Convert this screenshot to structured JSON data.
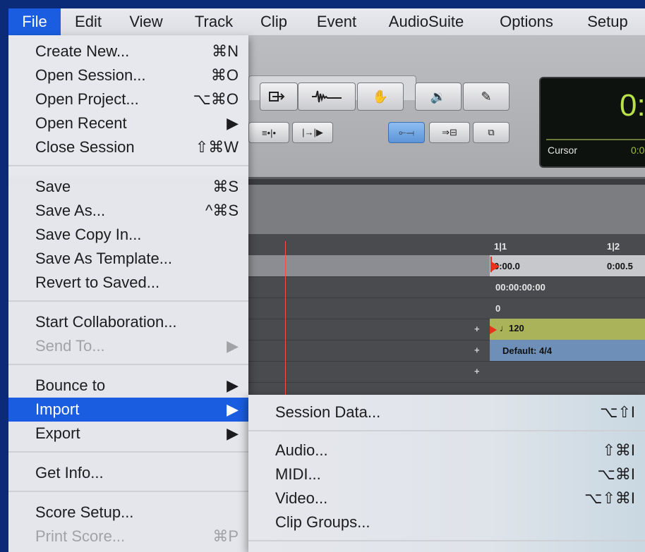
{
  "menubar": {
    "items": [
      "File",
      "Edit",
      "View",
      "Track",
      "Clip",
      "Event",
      "AudioSuite",
      "Options",
      "Setup"
    ]
  },
  "counter": {
    "main": "0:",
    "cursor_label": "Cursor",
    "cursor_value": "0:0"
  },
  "rulers": {
    "bar1": "1|1",
    "bar2": "1|2",
    "min_a": "0:00.0",
    "min_b": "0:00.5",
    "timecode": "00:00:00:00",
    "samples": "0",
    "tempo": "120",
    "meter": "Default: 4/4",
    "plus": "+"
  },
  "file_menu": {
    "items": [
      {
        "label": "Create New...",
        "shortcut": "⌘N"
      },
      {
        "label": "Open Session...",
        "shortcut": "⌘O"
      },
      {
        "label": "Open Project...",
        "shortcut": "⌥⌘O"
      },
      {
        "label": "Open Recent",
        "shortcut": "▶"
      },
      {
        "label": "Close Session",
        "shortcut": "⇧⌘W"
      },
      {
        "label": "Save",
        "shortcut": "⌘S"
      },
      {
        "label": "Save As...",
        "shortcut": "^⌘S"
      },
      {
        "label": "Save Copy In...",
        "shortcut": ""
      },
      {
        "label": "Save As Template...",
        "shortcut": ""
      },
      {
        "label": "Revert to Saved...",
        "shortcut": ""
      },
      {
        "label": "Start Collaboration...",
        "shortcut": ""
      },
      {
        "label": "Send To...",
        "shortcut": "▶"
      },
      {
        "label": "Bounce to",
        "shortcut": "▶"
      },
      {
        "label": "Import",
        "shortcut": "▶"
      },
      {
        "label": "Export",
        "shortcut": "▶"
      },
      {
        "label": "Get Info...",
        "shortcut": ""
      },
      {
        "label": "Score Setup...",
        "shortcut": ""
      },
      {
        "label": "Print Score...",
        "shortcut": "⌘P"
      }
    ]
  },
  "import_submenu": {
    "items": [
      {
        "label": "Session Data...",
        "shortcut": "⌥⇧I"
      },
      {
        "label": "Audio...",
        "shortcut": "⇧⌘I"
      },
      {
        "label": "MIDI...",
        "shortcut": "⌥⌘I"
      },
      {
        "label": "Video...",
        "shortcut": "⌥⇧⌘I"
      },
      {
        "label": "Clip Groups...",
        "shortcut": ""
      }
    ]
  },
  "colors": {
    "highlight": "#1a5de0",
    "counter_text": "#b9e24a",
    "playhead": "#ff4a3a"
  }
}
